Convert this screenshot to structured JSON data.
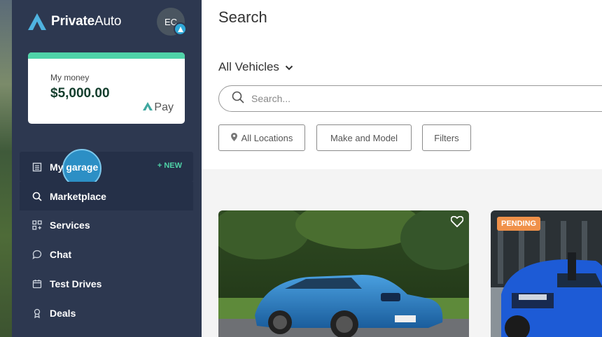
{
  "sidebar": {
    "logo": {
      "brand_part1": "Private",
      "brand_part2": "Auto"
    },
    "avatar": {
      "initials": "EC"
    },
    "money_card": {
      "label": "My money",
      "value": "$5,000.00",
      "pay_brand": "Pay"
    },
    "nav": [
      {
        "label": "My garage",
        "icon": "garage-icon",
        "badge": "+ NEW"
      },
      {
        "label": "Marketplace",
        "icon": "search-icon"
      },
      {
        "label": "Services",
        "icon": "services-icon"
      },
      {
        "label": "Chat",
        "icon": "chat-icon"
      },
      {
        "label": "Test Drives",
        "icon": "calendar-icon"
      },
      {
        "label": "Deals",
        "icon": "ribbon-icon"
      }
    ]
  },
  "main": {
    "title": "Search",
    "vehicle_filter": "All Vehicles",
    "search": {
      "placeholder": "Search..."
    },
    "filters": {
      "locations": "All Locations",
      "make_model": "Make and Model",
      "filters": "Filters"
    },
    "listings": [
      {
        "color": "blue BMW coupe",
        "badge": ""
      },
      {
        "color": "blue Toyota truck",
        "badge": "PENDING"
      }
    ]
  },
  "colors": {
    "sidebar": "#2d3850",
    "accent": "#4fd3a8",
    "pending": "#f0914a",
    "highlight": "#2ea0dc"
  }
}
